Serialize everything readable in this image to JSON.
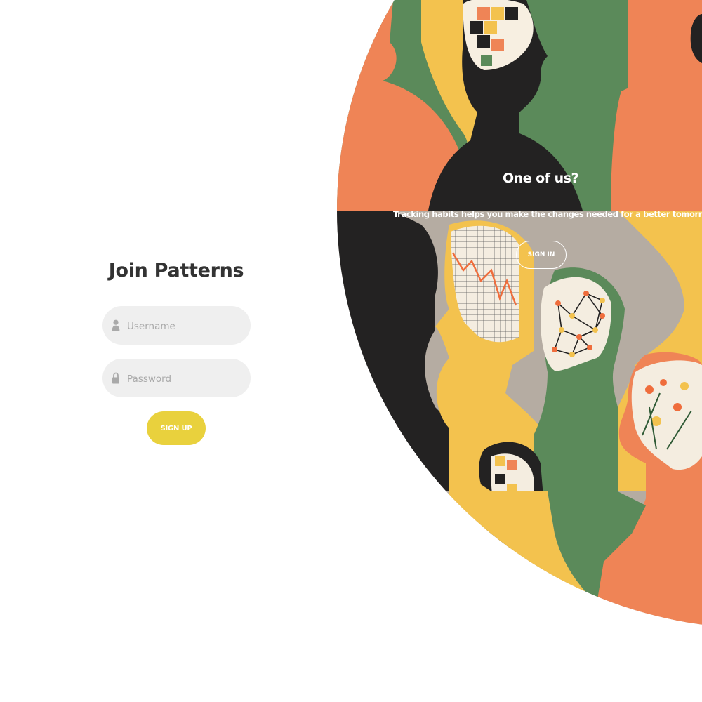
{
  "signup_form": {
    "title": "Join Patterns",
    "username": {
      "placeholder": "Username",
      "value": "",
      "icon": "user-icon"
    },
    "password": {
      "placeholder": "Password",
      "value": "",
      "icon": "lock-icon"
    },
    "submit_label": "SIGN UP"
  },
  "signin_panel": {
    "title": "One of us?",
    "text": "Tracking habits helps you make the changes needed for a better tomorrow.",
    "button_label": "SIGN IN"
  },
  "colors": {
    "accent_yellow": "#e9d13d",
    "orange": "#ef8456",
    "green": "#5b8a5a",
    "mustard": "#f3c24e",
    "black": "#232222",
    "taupe": "#b5aca2"
  }
}
